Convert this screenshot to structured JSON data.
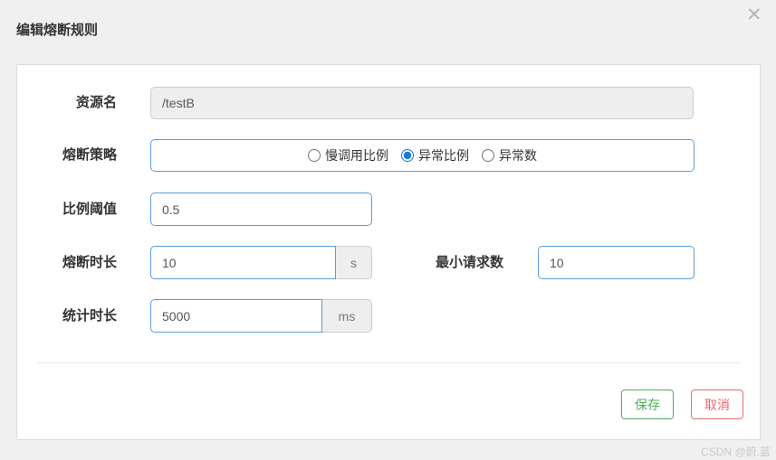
{
  "dialog": {
    "title": "编辑熔断规则",
    "close_icon": "✕"
  },
  "form": {
    "resource": {
      "label": "资源名",
      "value": "/testB",
      "disabled": true
    },
    "strategy": {
      "label": "熔断策略",
      "options": [
        {
          "label": "慢调用比例",
          "selected": false
        },
        {
          "label": "异常比例",
          "selected": true
        },
        {
          "label": "异常数",
          "selected": false
        }
      ]
    },
    "ratio_threshold": {
      "label": "比例阈值",
      "value": "0.5"
    },
    "break_duration": {
      "label": "熔断时长",
      "value": "10",
      "unit": "s"
    },
    "min_requests": {
      "label": "最小请求数",
      "value": "10"
    },
    "stat_duration": {
      "label": "统计时长",
      "value": "5000",
      "unit": "ms"
    }
  },
  "footer": {
    "save_label": "保存",
    "cancel_label": "取消"
  },
  "watermark": "CSDN @蔚.蓝",
  "colors": {
    "accent_blue": "#5a9cd8",
    "radio_blue": "#2077d4",
    "save_green": "#4caf50",
    "cancel_red": "#e9686b",
    "page_bg": "#f0f0f0"
  }
}
